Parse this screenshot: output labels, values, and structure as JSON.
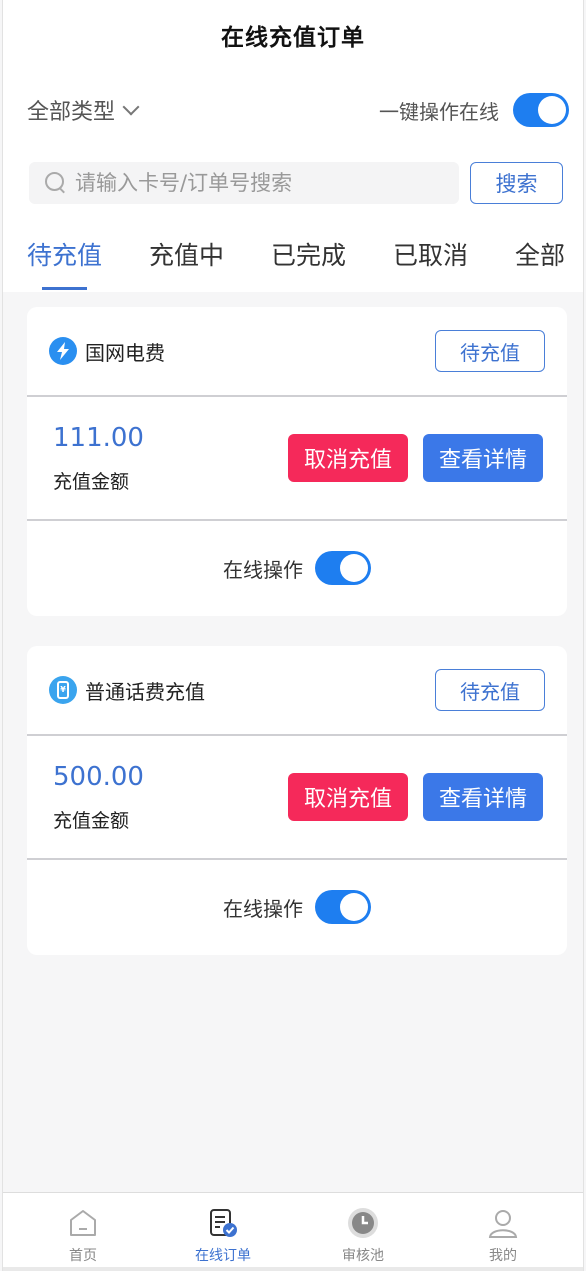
{
  "header": {
    "title": "在线充值订单"
  },
  "filter": {
    "type_label": "全部类型",
    "one_key_label": "一键操作在线",
    "one_key_on": true
  },
  "search": {
    "placeholder": "请输入卡号/订单号搜索",
    "value": "",
    "button_label": "搜索"
  },
  "tabs": [
    {
      "label": "待充值",
      "active": true
    },
    {
      "label": "充值中",
      "active": false
    },
    {
      "label": "已完成",
      "active": false
    },
    {
      "label": "已取消",
      "active": false
    },
    {
      "label": "全部",
      "active": false
    }
  ],
  "orders": [
    {
      "icon": "lightning-icon",
      "name": "国网电费",
      "status": "待充值",
      "amount": "111.00",
      "amount_label": "充值金额",
      "cancel_label": "取消充值",
      "detail_label": "查看详情",
      "online_label": "在线操作",
      "online_on": true
    },
    {
      "icon": "phone-icon",
      "name": "普通话费充值",
      "status": "待充值",
      "amount": "500.00",
      "amount_label": "充值金额",
      "cancel_label": "取消充值",
      "detail_label": "查看详情",
      "online_label": "在线操作",
      "online_on": true
    }
  ],
  "nav": [
    {
      "label": "首页",
      "icon": "home-icon",
      "active": false
    },
    {
      "label": "在线订单",
      "icon": "order-icon",
      "active": true
    },
    {
      "label": "审核池",
      "icon": "clock-icon",
      "active": false
    },
    {
      "label": "我的",
      "icon": "user-icon",
      "active": false
    }
  ],
  "colors": {
    "accent": "#3d72d0",
    "danger": "#f5295a",
    "primary_btn": "#3b78e8",
    "toggle": "#1e7ef0"
  }
}
